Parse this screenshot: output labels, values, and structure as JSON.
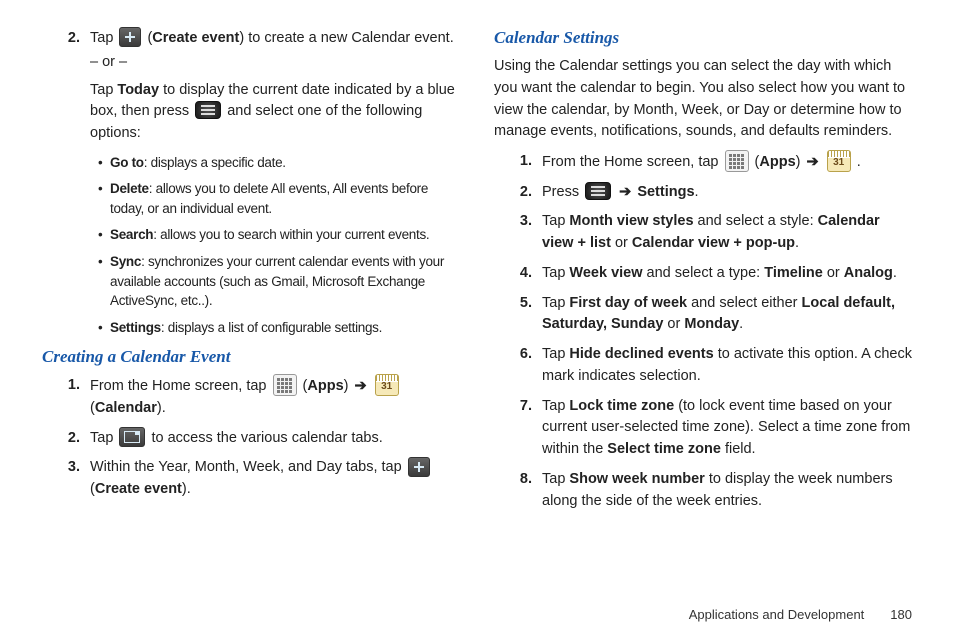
{
  "left": {
    "step2_num": "2.",
    "step2_a": "Tap ",
    "step2_b": " (",
    "step2_bold": "Create event",
    "step2_c": ") to create a new Calendar event.",
    "or": "– or –",
    "step2d_a": "Tap ",
    "step2d_bold": "Today",
    "step2d_b": " to display the current date indicated by a blue box, then press ",
    "step2d_c": " and select one of the following options:",
    "bullets": [
      {
        "bold": "Go to",
        "text": ": displays a specific date."
      },
      {
        "bold": "Delete",
        "text": ": allows you to delete All events, All events before today, or an individual event."
      },
      {
        "bold": "Search",
        "text": ": allows you to search within your current events."
      },
      {
        "bold": "Sync",
        "text": ": synchronizes your current calendar events with your available accounts (such as Gmail, Microsoft Exchange ActiveSync, etc..)."
      },
      {
        "bold": "Settings",
        "text": ": displays a list of configurable settings."
      }
    ],
    "heading_create": "Creating a Calendar Event",
    "c1_num": "1.",
    "c1_a": "From the Home screen, tap ",
    "c1_b": " (",
    "c1_apps": "Apps",
    "c1_c": ") ",
    "c1_d": " (",
    "c1_cal": "Calendar",
    "c1_e": ").",
    "c2_num": "2.",
    "c2_a": "Tap ",
    "c2_b": " to access the various calendar tabs.",
    "c3_num": "3.",
    "c3_a": "Within the Year, Month, Week, and Day tabs, tap ",
    "c3_b": " (",
    "c3_bold": "Create event",
    "c3_c": ")."
  },
  "right": {
    "heading_settings": "Calendar Settings",
    "intro": "Using the Calendar settings you can select the day with which you want the calendar to begin. You also select how you want to view the calendar, by Month, Week, or Day or determine how to manage events, notifications, sounds, and defaults reminders.",
    "s1_num": "1.",
    "s1_a": "From the Home screen, tap ",
    "s1_b": " (",
    "s1_apps": "Apps",
    "s1_c": ") ",
    "s1_d": " .",
    "s2_num": "2.",
    "s2_a": "Press ",
    "s2_b": " ",
    "s2_bold": "Settings",
    "s2_c": ".",
    "s3_num": "3.",
    "s3_a": "Tap ",
    "s3_b1": "Month view styles",
    "s3_c": " and select a style: ",
    "s3_b2": "Calendar view + list",
    "s3_d": " or ",
    "s3_b3": "Calendar view + pop-up",
    "s3_e": ".",
    "s4_num": "4.",
    "s4_a": "Tap ",
    "s4_b1": "Week view",
    "s4_b": " and select a type: ",
    "s4_b2": "Timeline",
    "s4_c": " or ",
    "s4_b3": "Analog",
    "s4_d": ".",
    "s5_num": "5.",
    "s5_a": "Tap ",
    "s5_b1": "First day of week",
    "s5_b": " and select either ",
    "s5_b2": "Local default, Saturday, Sunday",
    "s5_c": " or ",
    "s5_b3": "Monday",
    "s5_d": ".",
    "s6_num": "6.",
    "s6_a": "Tap ",
    "s6_b1": "Hide declined events",
    "s6_b": " to activate this option. A check mark indicates selection.",
    "s7_num": "7.",
    "s7_a": "Tap ",
    "s7_b1": "Lock time zone",
    "s7_b": " (to lock event time based on your current user-selected time zone). Select a time zone from within the ",
    "s7_b2": "Select time zone",
    "s7_c": " field.",
    "s8_num": "8.",
    "s8_a": "Tap ",
    "s8_b1": "Show week number",
    "s8_b": " to display the week numbers along the side of the week entries."
  },
  "footer": {
    "section": "Applications and Development",
    "page": "180"
  },
  "arrow": "➔",
  "cal_day": "31"
}
